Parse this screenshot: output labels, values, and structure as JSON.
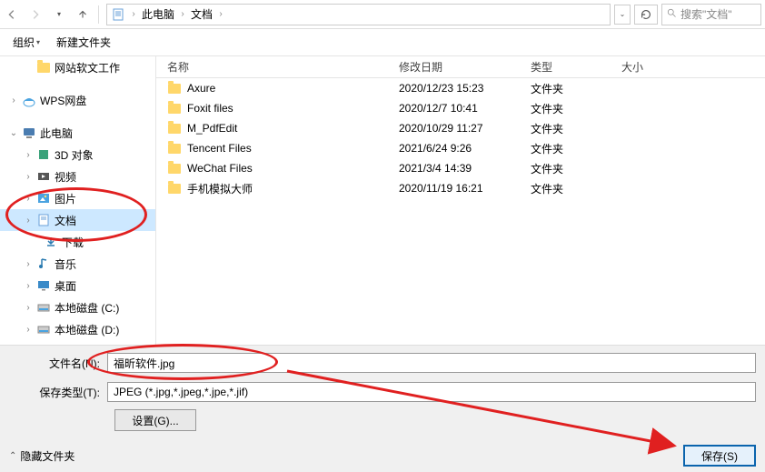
{
  "breadcrumb": {
    "root": "此电脑",
    "folder": "文档"
  },
  "search": {
    "placeholder": "搜索\"文档\""
  },
  "toolbar": {
    "organize": "组织",
    "new_folder": "新建文件夹"
  },
  "tree": {
    "items": [
      {
        "label": "网站软文工作",
        "icon": "folder",
        "indent": 1,
        "chev": ""
      },
      {
        "label": "WPS网盘",
        "icon": "wps",
        "indent": 0,
        "chev": ">"
      },
      {
        "label": "此电脑",
        "icon": "pc",
        "indent": 0,
        "chev": "v"
      },
      {
        "label": "3D 对象",
        "icon": "3d",
        "indent": 1,
        "chev": ">"
      },
      {
        "label": "视频",
        "icon": "video",
        "indent": 1,
        "chev": ">"
      },
      {
        "label": "图片",
        "icon": "pic",
        "indent": 1,
        "chev": ">"
      },
      {
        "label": "文档",
        "icon": "doc",
        "indent": 1,
        "chev": ">",
        "selected": true
      },
      {
        "label": "下载",
        "icon": "download",
        "indent": 1,
        "chev": ">"
      },
      {
        "label": "音乐",
        "icon": "music",
        "indent": 1,
        "chev": ">"
      },
      {
        "label": "桌面",
        "icon": "desktop",
        "indent": 1,
        "chev": ">"
      },
      {
        "label": "本地磁盘 (C:)",
        "icon": "disk",
        "indent": 1,
        "chev": ">"
      },
      {
        "label": "本地磁盘 (D:)",
        "icon": "disk",
        "indent": 1,
        "chev": ">"
      }
    ]
  },
  "columns": {
    "name": "名称",
    "date": "修改日期",
    "type": "类型",
    "size": "大小"
  },
  "files": [
    {
      "name": "Axure",
      "date": "2020/12/23 15:23",
      "type": "文件夹"
    },
    {
      "name": "Foxit files",
      "date": "2020/12/7 10:41",
      "type": "文件夹"
    },
    {
      "name": "M_PdfEdit",
      "date": "2020/10/29 11:27",
      "type": "文件夹"
    },
    {
      "name": "Tencent Files",
      "date": "2021/6/24 9:26",
      "type": "文件夹"
    },
    {
      "name": "WeChat Files",
      "date": "2021/3/4 14:39",
      "type": "文件夹"
    },
    {
      "name": "手机模拟大师",
      "date": "2020/11/19 16:21",
      "type": "文件夹"
    }
  ],
  "form": {
    "filename_label": "文件名(N):",
    "filename_value": "福昕软件.jpg",
    "filetype_label": "保存类型(T):",
    "filetype_value": "JPEG (*.jpg,*.jpeg,*.jpe,*.jif)",
    "settings_label": "设置(G)...",
    "hide_folders": "隐藏文件夹",
    "save_label": "保存(S)"
  },
  "colors": {
    "accent": "#0a64ad",
    "highlight": "#cde8ff",
    "annot": "#e02020"
  }
}
